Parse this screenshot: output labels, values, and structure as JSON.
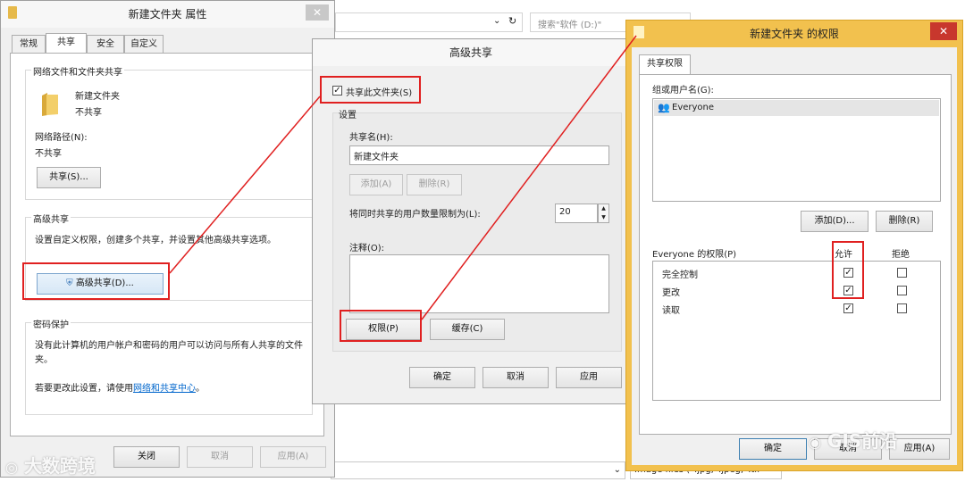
{
  "background": {
    "search_placeholder": "搜索\"软件 (D:)\"",
    "filetype_filter": "Image files (*.jpg;*.jpeg;*.tif",
    "dropdown_arrow": "chevron-down-icon"
  },
  "properties": {
    "title": "新建文件夹 属性",
    "tabs": [
      "常规",
      "共享",
      "安全",
      "自定义"
    ],
    "section_network": "网络文件和文件夹共享",
    "folder_name": "新建文件夹",
    "folder_status": "不共享",
    "network_path_label": "网络路径(N):",
    "network_path_value": "不共享",
    "share_button": "共享(S)...",
    "section_advanced": "高级共享",
    "advanced_desc": "设置自定义权限，创建多个共享，并设置其他高级共享选项。",
    "advanced_button": "高级共享(D)...",
    "section_password": "密码保护",
    "password_desc": "没有此计算机的用户帐户和密码的用户可以访问与所有人共享的文件夹。",
    "change_prefix": "若要更改此设置，请使用",
    "change_link": "网络和共享中心",
    "change_suffix": "。",
    "close_button": "关闭",
    "cancel_button": "取消",
    "apply_button": "应用(A)"
  },
  "advanced_share": {
    "title": "高级共享",
    "share_checkbox_label": "共享此文件夹(S)",
    "share_checked": true,
    "settings_label": "设置",
    "share_name_label": "共享名(H):",
    "share_name_value": "新建文件夹",
    "add_button": "添加(A)",
    "remove_button": "删除(R)",
    "limit_label": "将同时共享的用户数量限制为(L):",
    "limit_value": "20",
    "comment_label": "注释(O):",
    "permissions_button": "权限(P)",
    "cache_button": "缓存(C)",
    "ok_button": "确定",
    "cancel_button": "取消",
    "apply_button": "应用"
  },
  "permissions": {
    "title": "新建文件夹 的权限",
    "tab": "共享权限",
    "group_label": "组或用户名(G):",
    "users": [
      "Everyone"
    ],
    "add_button": "添加(D)...",
    "remove_button": "删除(R)",
    "perm_label": "Everyone 的权限(P)",
    "allow_header": "允许",
    "deny_header": "拒绝",
    "rows": [
      {
        "name": "完全控制",
        "allow": true,
        "deny": false
      },
      {
        "name": "更改",
        "allow": true,
        "deny": false
      },
      {
        "name": "读取",
        "allow": true,
        "deny": false
      }
    ],
    "ok_button": "确定",
    "cancel_button": "取消",
    "apply_button": "应用(A)"
  },
  "watermarks": {
    "left": "大数跨境",
    "right": "GIS前沿"
  },
  "colors": {
    "accent_red": "#e02020",
    "title_yellow": "#f2c14e",
    "close_red": "#c8372d",
    "link_blue": "#0066cc"
  }
}
